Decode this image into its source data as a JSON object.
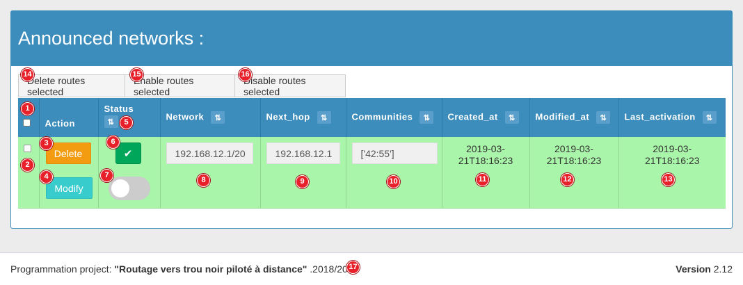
{
  "panel": {
    "title": "Announced networks :"
  },
  "bulk_actions": {
    "delete_label": "Delete routes selected",
    "enable_label": "Enable routes selected",
    "disable_label": "Disable routes selected"
  },
  "table": {
    "headers": {
      "action": "Action",
      "status": "Status",
      "network": "Network",
      "next_hop": "Next_hop",
      "communities": "Communities",
      "created_at": "Created_at",
      "modified_at": "Modified_at",
      "last_activation": "Last_activation"
    },
    "row": {
      "delete_label": "Delete",
      "modify_label": "Modify",
      "network": "192.168.12.1/20",
      "next_hop": "192.168.12.1",
      "communities": "['42:55']",
      "created_at_line1": "2019-03-",
      "created_at_line2": "21T18:16:23",
      "modified_at_line1": "2019-03-",
      "modified_at_line2": "21T18:16:23",
      "last_activation_line1": "2019-03-",
      "last_activation_line2": "21T18:16:23",
      "status_enabled": false
    }
  },
  "footer": {
    "prefix": "Programmation project: ",
    "project_name": "\"Routage vers trou noir piloté à distance\"",
    "suffix": " .2018/2019",
    "version_label": "Version",
    "version_number": " 2.12"
  },
  "markers": [
    "1",
    "2",
    "3",
    "4",
    "5",
    "6",
    "7",
    "8",
    "9",
    "10",
    "11",
    "12",
    "13",
    "14",
    "15",
    "16",
    "17"
  ],
  "icons": {
    "sort": "sort-icon",
    "check": "check-icon"
  },
  "colors": {
    "primary": "#3c8dbc",
    "row_bg": "#a9f5a9",
    "delete": "#f39c12",
    "modify": "#39cccc",
    "success": "#00a65a",
    "marker": "#e8202a"
  }
}
